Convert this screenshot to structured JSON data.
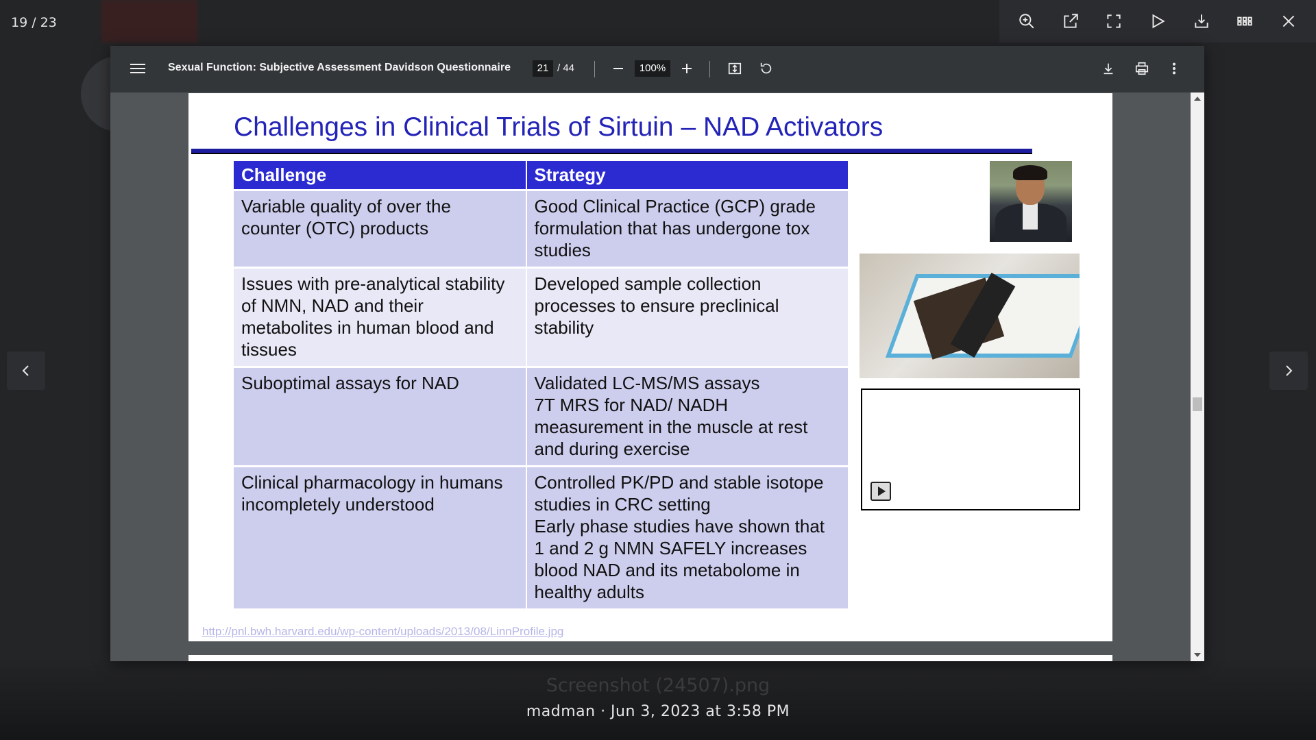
{
  "lightbox": {
    "counter": "19 / 23",
    "toolbar_icons": [
      "zoom-in-icon",
      "open-external-icon",
      "fullscreen-icon",
      "play-icon",
      "download-icon",
      "grid-icon",
      "close-icon"
    ],
    "caption_filename": "Screenshot (24507).png",
    "caption_meta": "madman · Jun 3, 2023 at 3:58 PM"
  },
  "pdf": {
    "title": "Sexual Function: Subjective Assessment Davidson Questionnaire",
    "current_page": "21",
    "total_pages": "/ 44",
    "zoom": "100%"
  },
  "slide": {
    "title": "Challenges in Clinical Trials of Sirtuin – NAD Activators",
    "headers": {
      "challenge": "Challenge",
      "strategy": "Strategy"
    },
    "rows": [
      {
        "challenge": [
          "Variable quality of over the",
          "counter (OTC) products"
        ],
        "strategy": [
          "Good Clinical Practice (GCP) grade",
          "formulation that has undergone tox",
          "studies"
        ]
      },
      {
        "challenge": [
          "Issues with pre-analytical stability",
          "of NMN, NAD and their",
          "metabolites in human blood and",
          "tissues"
        ],
        "strategy": [
          "Developed sample collection",
          "processes to ensure preclinical",
          "stability"
        ]
      },
      {
        "challenge": [
          "Suboptimal assays for NAD"
        ],
        "strategy": [
          "Validated LC-MS/MS assays",
          "7T MRS for NAD/ NADH",
          "measurement in the muscle at rest",
          "and during exercise"
        ]
      },
      {
        "challenge": [
          "Clinical pharmacology in humans",
          "incompletely understood"
        ],
        "strategy": [
          "Controlled PK/PD and stable isotope",
          "studies in CRC setting",
          "Early phase studies have shown that",
          "1 and 2 g NMN SAFELY increases",
          "blood NAD and its metabolome in",
          "healthy adults"
        ]
      }
    ],
    "source_link": "http://pnl.bwh.harvard.edu/wp-content/uploads/2013/08/LinnProfile.jpg"
  },
  "colors": {
    "title_blue": "#2323b8",
    "header_blue": "#2b2bd1",
    "row_dark": "#cdcdee",
    "row_light": "#e8e8f6",
    "pdf_toolbar": "#323639"
  }
}
